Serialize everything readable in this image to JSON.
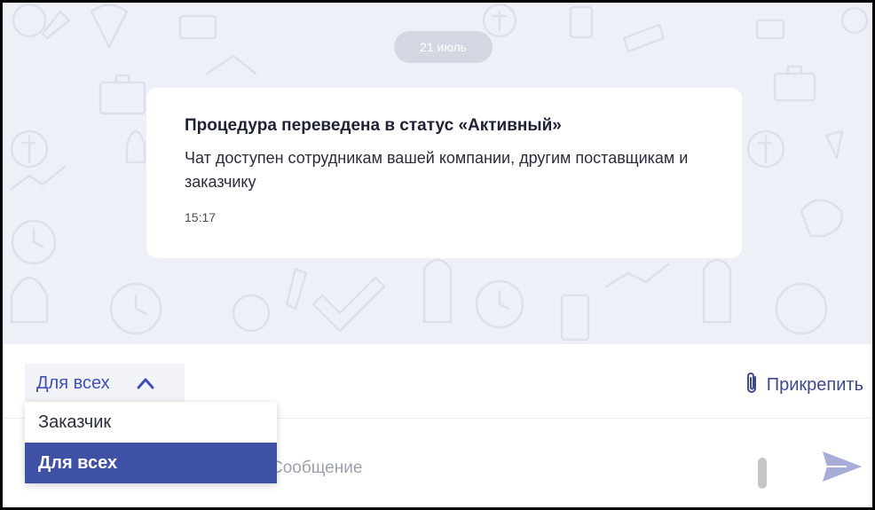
{
  "chat": {
    "date_divider": "21 июль",
    "message": {
      "title": "Процедура переведена в статус «Активный»",
      "body": "Чат доступен сотрудникам вашей компании, другим поставщикам и заказчику",
      "time": "15:17"
    }
  },
  "composer": {
    "audience_selected": "Для всех",
    "audience_options": [
      "Заказчик",
      "Для всех"
    ],
    "attach_label": "Прикрепить",
    "input_placeholder": "Сообщение",
    "input_visible_text": "ме",
    "send_icon": "send-icon"
  },
  "colors": {
    "accent": "#3f51b5",
    "chat_background": "#eef0f7",
    "selected_option": "#3f51a5"
  }
}
